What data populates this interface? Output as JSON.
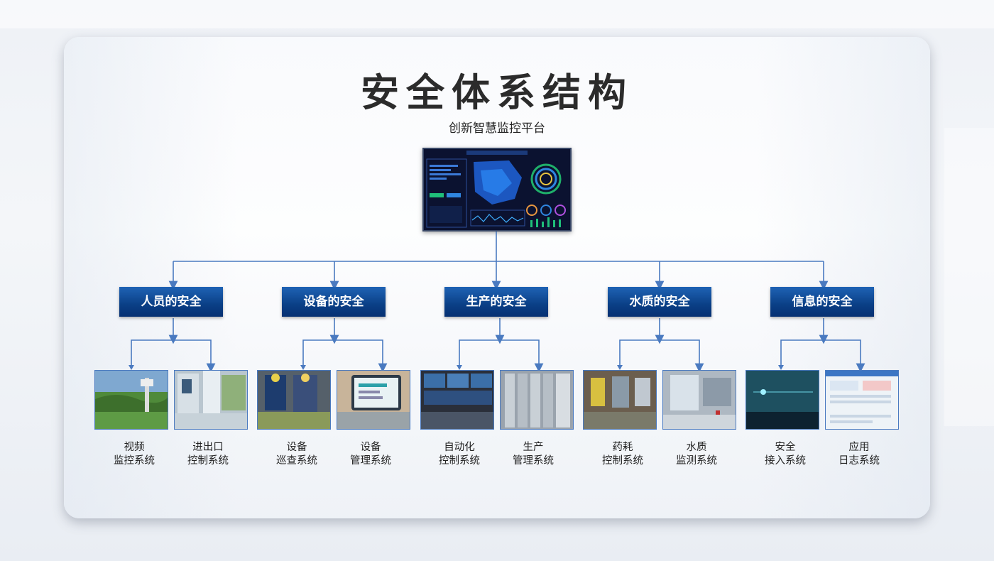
{
  "title": "安全体系结构",
  "subtitle": "创新智慧监控平台",
  "categories": [
    {
      "label": "人员的安全",
      "systems": [
        {
          "l1": "视频",
          "l2": "监控系统"
        },
        {
          "l1": "进出口",
          "l2": "控制系统"
        }
      ]
    },
    {
      "label": "设备的安全",
      "systems": [
        {
          "l1": "设备",
          "l2": "巡查系统"
        },
        {
          "l1": "设备",
          "l2": "管理系统"
        }
      ]
    },
    {
      "label": "生产的安全",
      "systems": [
        {
          "l1": "自动化",
          "l2": "控制系统"
        },
        {
          "l1": "生产",
          "l2": "管理系统"
        }
      ]
    },
    {
      "label": "水质的安全",
      "systems": [
        {
          "l1": "药耗",
          "l2": "控制系统"
        },
        {
          "l1": "水质",
          "l2": "监测系统"
        }
      ]
    },
    {
      "label": "信息的安全",
      "systems": [
        {
          "l1": "安全",
          "l2": "接入系统"
        },
        {
          "l1": "应用",
          "l2": "日志系统"
        }
      ]
    }
  ],
  "colors": {
    "connector": "#4a7ac0",
    "category_fill": "#0a3f86"
  }
}
